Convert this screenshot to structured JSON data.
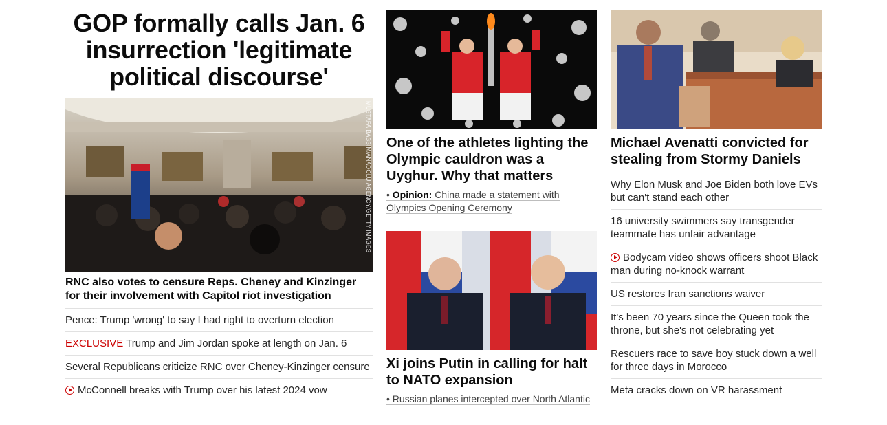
{
  "main": {
    "headline": "GOP formally calls Jan. 6 insurrection 'legitimate political discourse'",
    "image_credit": "MUSTAFA BASSIM/ANADOLU AGENCY/GETTY IMAGES",
    "subheadline": "RNC also votes to censure Reps. Cheney and Kinzinger for their involvement with Capitol riot investigation",
    "links": [
      {
        "label": "",
        "text": "Pence: Trump 'wrong' to say I had right to overturn election",
        "video": false
      },
      {
        "label": "EXCLUSIVE",
        "text": " Trump and Jim Jordan spoke at length on Jan. 6",
        "video": false
      },
      {
        "label": "",
        "text": "Several Republicans criticize RNC over Cheney-Kinzinger censure",
        "video": false
      },
      {
        "label": "",
        "text": "McConnell breaks with Trump over his latest 2024 vow",
        "video": true
      }
    ]
  },
  "middle": {
    "card1": {
      "title": "One of the athletes lighting the Olympic cauldron was a Uyghur. Why that matters",
      "sub_label": "Opinion:",
      "sub_text": " China made a statement with Olympics Opening Ceremony"
    },
    "card2": {
      "title": "Xi joins Putin in calling for halt to NATO expansion",
      "sub_text": "Russian planes intercepted over North Atlantic"
    }
  },
  "right": {
    "title": "Michael Avenatti convicted for stealing from Stormy Daniels",
    "links": [
      {
        "text": "Why Elon Musk and Joe Biden both love EVs but can't stand each other",
        "video": false
      },
      {
        "text": "16 university swimmers say transgender teammate has unfair advantage",
        "video": false
      },
      {
        "text": "Bodycam video shows officers shoot Black man during no-knock warrant",
        "video": true
      },
      {
        "text": "US restores Iran sanctions waiver",
        "video": false
      },
      {
        "text": "It's been 70 years since the Queen took the throne, but she's not celebrating yet",
        "video": false
      },
      {
        "text": "Rescuers race to save boy stuck down a well for three days in Morocco",
        "video": false
      },
      {
        "text": "Meta cracks down on VR harassment",
        "video": false
      }
    ]
  },
  "colors": {
    "accent": "#cc0000",
    "text": "#262626",
    "divider": "#e1e1e1"
  }
}
